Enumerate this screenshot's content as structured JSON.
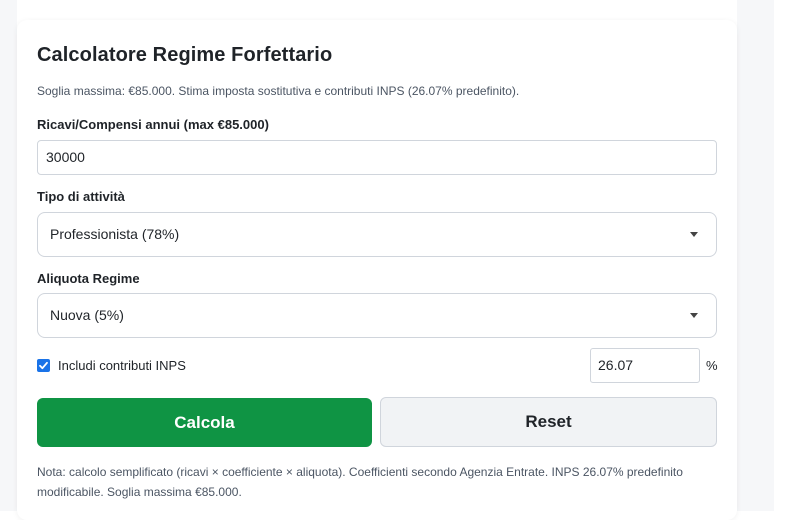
{
  "calculator": {
    "title": "Calcolatore Regime Forfettario",
    "subtitle": "Soglia massima: €85.000. Stima imposta sostitutiva e contributi INPS (26.07% predefinito).",
    "revenue": {
      "label": "Ricavi/Compensi annui (max €85.000)",
      "value": "30000"
    },
    "activity": {
      "label": "Tipo di attività",
      "selected": "Professionista (78%)"
    },
    "rate": {
      "label": "Aliquota Regime",
      "selected": "Nuova (5%)"
    },
    "inps": {
      "label": "Includi contributi INPS",
      "checked": true,
      "value": "26.07",
      "unit": "%"
    },
    "buttons": {
      "calculate": "Calcola",
      "reset": "Reset"
    },
    "note": "Nota: calcolo semplificato (ricavi × coefficiente × aliquota). Coefficienti secondo Agenzia Entrate. INPS 26.07% predefinito modificabile. Soglia massima €85.000.",
    "colors": {
      "primary": "#0f9444",
      "checkbox": "#1a73e8",
      "secondary_bg": "#f1f3f5"
    },
    "icons": {
      "select_caret": "chevron-down-icon",
      "checkbox_mark": "checkmark-icon"
    }
  }
}
